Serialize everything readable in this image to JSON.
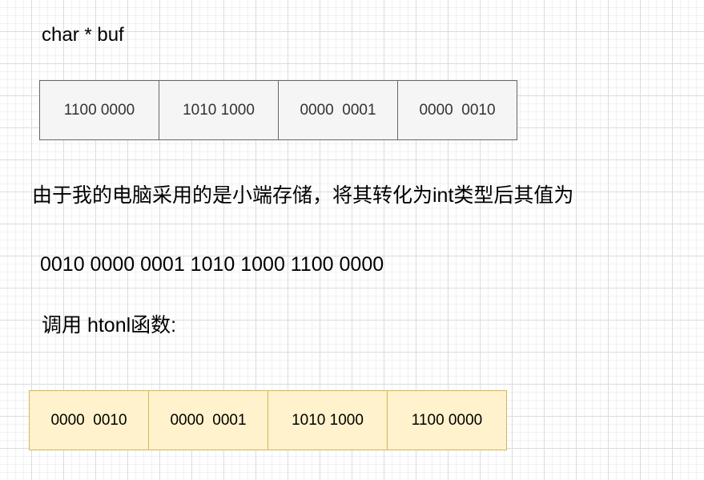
{
  "buf_label": "char * buf",
  "original_bytes": [
    "1100 0000",
    "1010 1000",
    "0000  0001",
    "0000  0010"
  ],
  "little_endian_note": "由于我的电脑采用的是小端存储，将其转化为int类型后其值为",
  "int_value": "0010 0000 0001 1010 1000 1100 0000",
  "htonl_note": "调用 htonl函数:",
  "htonl_bytes": [
    "0000  0010",
    "0000  0001",
    "1010 1000",
    "1100 0000"
  ],
  "colors": {
    "original_fill": "#f5f5f5",
    "original_stroke": "#666666",
    "htonl_fill": "#fff2cc",
    "htonl_stroke": "#d6b656"
  }
}
